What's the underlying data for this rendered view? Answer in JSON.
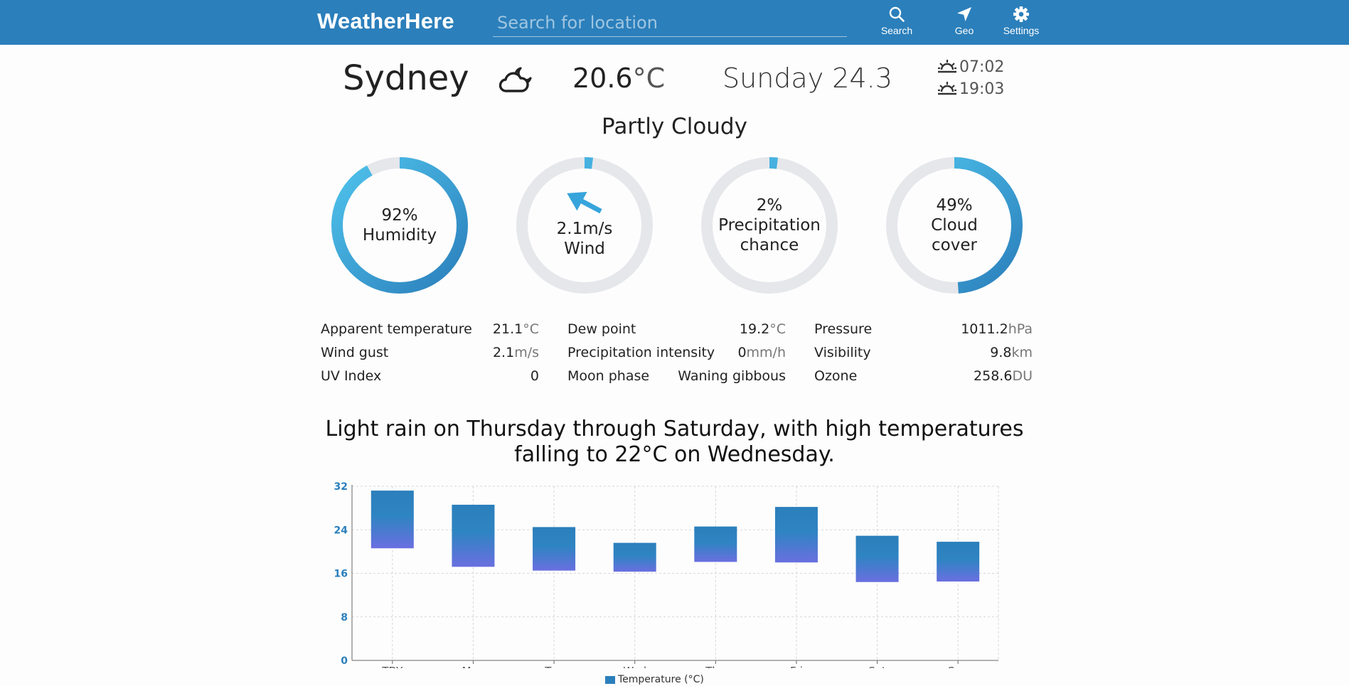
{
  "app": {
    "brand": "WeatherHere",
    "search": {
      "placeholder": "Search for location",
      "value": ""
    },
    "nav": [
      {
        "label": "Search",
        "icon": "search-icon"
      },
      {
        "label": "Geo",
        "icon": "location-arrow-icon"
      },
      {
        "label": "Settings",
        "icon": "gear-icon"
      }
    ]
  },
  "current": {
    "city": "Sydney",
    "condition_icon": "partly-cloudy-night-icon",
    "temperature": "20.6",
    "temperature_unit": "°C",
    "date": "Sunday 24.3",
    "sunrise": "07:02",
    "sunset": "19:03",
    "summary": "Partly Cloudy"
  },
  "gauges": [
    {
      "value_text": "92%",
      "label_lines": [
        "Humidity"
      ],
      "fraction": 0.92,
      "type": "percent"
    },
    {
      "value_text": "2.1m/s",
      "label_lines": [
        "Wind"
      ],
      "fraction": 0.02,
      "type": "wind",
      "wind_direction_deg": 300
    },
    {
      "value_text": "2%",
      "label_lines": [
        "Precipitation",
        "chance"
      ],
      "fraction": 0.02,
      "type": "percent"
    },
    {
      "value_text": "49%",
      "label_lines": [
        "Cloud",
        "cover"
      ],
      "fraction": 0.49,
      "type": "percent"
    }
  ],
  "details": [
    [
      {
        "label": "Apparent temperature",
        "value": "21.1",
        "unit": "°C"
      },
      {
        "label": "Wind gust",
        "value": "2.1",
        "unit": "m/s"
      },
      {
        "label": "UV Index",
        "value": "0",
        "unit": ""
      }
    ],
    [
      {
        "label": "Dew point",
        "value": "19.2",
        "unit": "°C"
      },
      {
        "label": "Precipitation intensity",
        "value": "0",
        "unit": "mm/h"
      },
      {
        "label": "Moon phase",
        "value": "Waning gibbous",
        "unit": ""
      }
    ],
    [
      {
        "label": "Pressure",
        "value": "1011.2",
        "unit": "hPa"
      },
      {
        "label": "Visibility",
        "value": "9.8",
        "unit": "km"
      },
      {
        "label": "Ozone",
        "value": "258.6",
        "unit": "DU"
      }
    ]
  ],
  "forecast": {
    "summary": "Light rain on Thursday through Saturday, with high temperatures falling to 22°C on Wednesday."
  },
  "colors": {
    "accent": "#2b7fbb",
    "gauge_light": "#4fc3ec",
    "gauge_dark": "#2b7fbb",
    "track": "#e6e7eb",
    "bar_bottom": "#6a6fe0"
  },
  "chart_data": {
    "type": "bar",
    "subtype": "floating-range",
    "categories": [
      "TDY",
      "Mon",
      "Tue",
      "Wed",
      "Thu",
      "Fri",
      "Sat",
      "Sun"
    ],
    "series": [
      {
        "name": "Temperature (°C)",
        "low": [
          20.6,
          17.2,
          16.5,
          16.3,
          18.1,
          18.0,
          14.4,
          14.5
        ],
        "high": [
          31.2,
          28.6,
          24.5,
          21.6,
          24.6,
          28.2,
          22.9,
          21.8
        ]
      }
    ],
    "ylim": [
      0,
      32
    ],
    "yticks": [
      0,
      8,
      16,
      24,
      32
    ],
    "grid": true,
    "legend": "bottom"
  }
}
